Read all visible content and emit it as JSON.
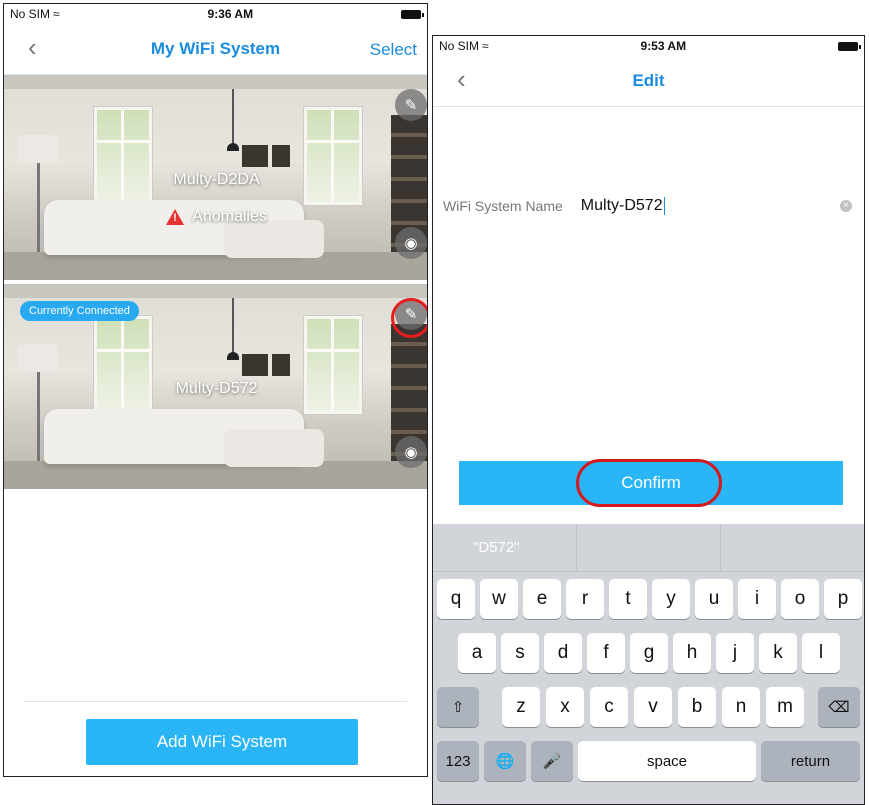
{
  "left_screen": {
    "status": {
      "carrier": "No SIM",
      "time": "9:36 AM"
    },
    "nav": {
      "title": "My WiFi System",
      "action": "Select"
    },
    "systems": [
      {
        "name": "Multy-D2DA",
        "alert": "Anomalies"
      },
      {
        "name": "Multy-D572",
        "badge": "Currently Connected"
      }
    ],
    "add_button": "Add WiFi System"
  },
  "right_screen": {
    "status": {
      "carrier": "No SIM",
      "time": "9:53 AM"
    },
    "nav": {
      "title": "Edit"
    },
    "field": {
      "label": "WiFi System Name",
      "value": "Multy-D572"
    },
    "confirm_button": "Confirm",
    "keyboard": {
      "suggestions": [
        "\"D572\"",
        "",
        ""
      ],
      "row1": [
        "q",
        "w",
        "e",
        "r",
        "t",
        "y",
        "u",
        "i",
        "o",
        "p"
      ],
      "row2": [
        "a",
        "s",
        "d",
        "f",
        "g",
        "h",
        "j",
        "k",
        "l"
      ],
      "row3": [
        "z",
        "x",
        "c",
        "v",
        "b",
        "n",
        "m"
      ],
      "numbers_key": "123",
      "space_key": "space",
      "return_key": "return"
    }
  }
}
